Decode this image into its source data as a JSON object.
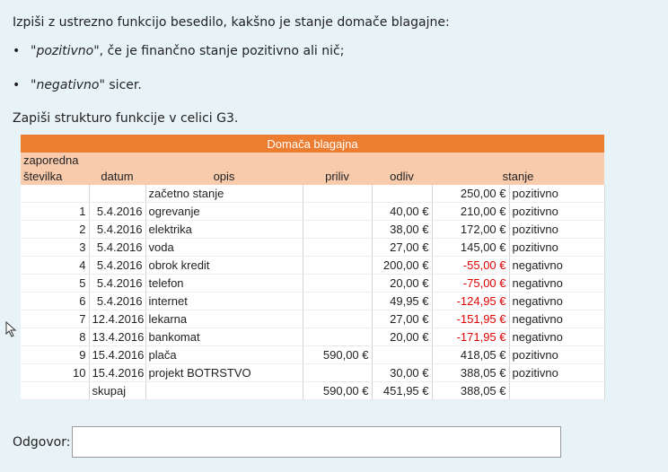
{
  "instruction": {
    "line1": "Izpiši z ustrezno funkcijo besedilo, kakšno je stanje domače blagajne:",
    "bullets": [
      {
        "quoted": "\"pozitivno\"",
        "rest": ", če je finančno stanje pozitivno ali nič;"
      },
      {
        "quoted": "\"negativno\"",
        "rest": " sicer."
      }
    ],
    "line2": "Zapiši strukturo funkcije v celici G3."
  },
  "table": {
    "title": "Domača blagajna",
    "header_top": "zaporedna",
    "headers": [
      "številka",
      "datum",
      "opis",
      "priliv",
      "odliv",
      "stanje"
    ],
    "rows": [
      {
        "num": "",
        "date": "",
        "desc": "začetno stanje",
        "in": "",
        "out": "",
        "bal": "250,00 €",
        "state": "pozitivno",
        "neg": false
      },
      {
        "num": "1",
        "date": "5.4.2016",
        "desc": "ogrevanje",
        "in": "",
        "out": "40,00 €",
        "bal": "210,00 €",
        "state": "pozitivno",
        "neg": false
      },
      {
        "num": "2",
        "date": "5.4.2016",
        "desc": "elektrika",
        "in": "",
        "out": "38,00 €",
        "bal": "172,00 €",
        "state": "pozitivno",
        "neg": false
      },
      {
        "num": "3",
        "date": "5.4.2016",
        "desc": "voda",
        "in": "",
        "out": "27,00 €",
        "bal": "145,00 €",
        "state": "pozitivno",
        "neg": false
      },
      {
        "num": "4",
        "date": "5.4.2016",
        "desc": "obrok kredit",
        "in": "",
        "out": "200,00 €",
        "bal": "-55,00 €",
        "state": "negativno",
        "neg": true
      },
      {
        "num": "5",
        "date": "5.4.2016",
        "desc": "telefon",
        "in": "",
        "out": "20,00 €",
        "bal": "-75,00 €",
        "state": "negativno",
        "neg": true
      },
      {
        "num": "6",
        "date": "5.4.2016",
        "desc": "internet",
        "in": "",
        "out": "49,95 €",
        "bal": "-124,95 €",
        "state": "negativno",
        "neg": true
      },
      {
        "num": "7",
        "date": "12.4.2016",
        "desc": "lekarna",
        "in": "",
        "out": "27,00 €",
        "bal": "-151,95 €",
        "state": "negativno",
        "neg": true
      },
      {
        "num": "8",
        "date": "13.4.2016",
        "desc": "bankomat",
        "in": "",
        "out": "20,00 €",
        "bal": "-171,95 €",
        "state": "negativno",
        "neg": true
      },
      {
        "num": "9",
        "date": "15.4.2016",
        "desc": "plača",
        "in": "590,00 €",
        "out": "",
        "bal": "418,05 €",
        "state": "pozitivno",
        "neg": false
      },
      {
        "num": "10",
        "date": "15.4.2016",
        "desc": "projekt BOTRSTVO",
        "in": "",
        "out": "30,00 €",
        "bal": "388,05 €",
        "state": "pozitivno",
        "neg": false
      }
    ],
    "total": {
      "label": "skupaj",
      "in": "590,00 €",
      "out": "451,95 €",
      "bal": "388,05 €"
    }
  },
  "answer": {
    "label": "Odgovor:",
    "value": ""
  },
  "colors": {
    "title_bg": "#ed7d31",
    "header_bg": "#f8cbad",
    "negative": "#e00000",
    "page_bg": "#e7f3f6"
  }
}
